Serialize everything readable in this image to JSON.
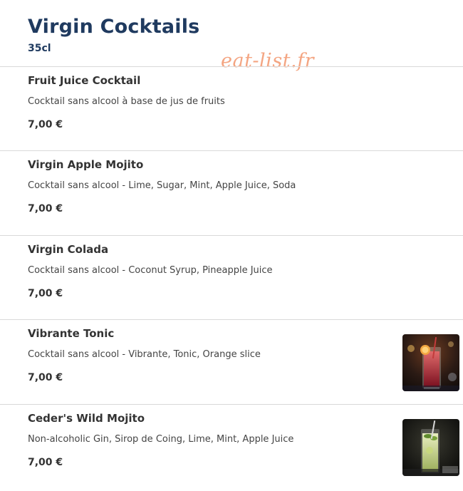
{
  "section": {
    "title": "Virgin Cocktails",
    "subtitle": "35cl",
    "watermark": "eat-list.fr"
  },
  "items": [
    {
      "name": "Fruit Juice Cocktail",
      "description": "Cocktail sans alcool à base de jus de fruits",
      "price": "7,00 €"
    },
    {
      "name": "Virgin Apple Mojito",
      "description": "Cocktail sans alcool - Lime, Sugar, Mint, Apple Juice, Soda",
      "price": "7,00 €"
    },
    {
      "name": "Virgin Colada",
      "description": "Cocktail sans alcool - Coconut Syrup, Pineapple Juice",
      "price": "7,00 €"
    },
    {
      "name": "Vibrante Tonic",
      "description": "Cocktail sans alcool - Vibrante, Tonic, Orange slice",
      "price": "7,00 €"
    },
    {
      "name": "Ceder's Wild Mojito",
      "description": "Non-alcoholic Gin, Sirop de Coing, Lime, Mint, Apple Juice",
      "price": "7,00 €"
    }
  ],
  "colors": {
    "heading": "#1f3a5f",
    "watermark": "#f4a582",
    "divider": "#d9d9d9"
  }
}
